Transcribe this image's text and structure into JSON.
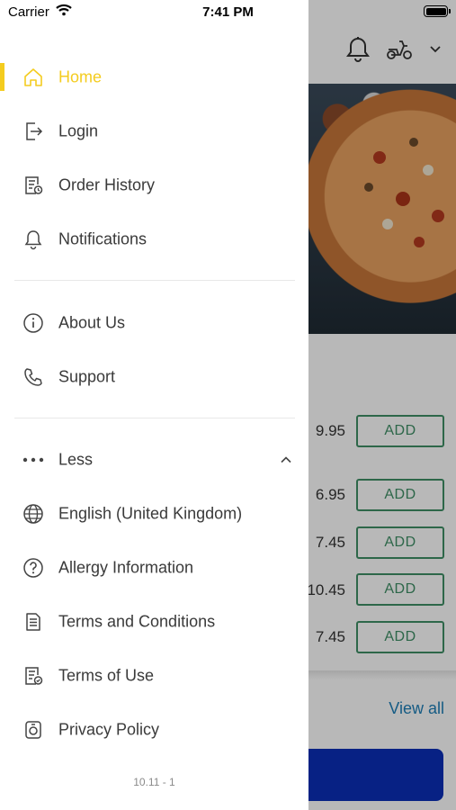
{
  "status_bar": {
    "carrier": "Carrier",
    "time": "7:41 PM"
  },
  "background": {
    "prices": [
      "9.95",
      "6.95",
      "7.45",
      "10.45",
      "7.45"
    ],
    "add_label": "ADD",
    "view_all": "View all",
    "icons": [
      "bell-icon",
      "scooter-icon",
      "chevron-down-icon"
    ]
  },
  "drawer": {
    "items": [
      {
        "label": "Home",
        "icon": "home-icon",
        "active": true
      },
      {
        "label": "Login",
        "icon": "login-icon"
      },
      {
        "label": "Order History",
        "icon": "order-history-icon"
      },
      {
        "label": "Notifications",
        "icon": "bell-icon"
      }
    ],
    "info_items": [
      {
        "label": "About Us",
        "icon": "info-icon"
      },
      {
        "label": "Support",
        "icon": "phone-icon"
      }
    ],
    "more_toggle": {
      "label": "Less",
      "icon": "ellipsis-icon",
      "state_icon": "chevron-up-icon"
    },
    "extra_items": [
      {
        "label": "English (United Kingdom)",
        "icon": "globe-icon"
      },
      {
        "label": "Allergy Information",
        "icon": "question-icon"
      },
      {
        "label": "Terms and Conditions",
        "icon": "document-icon"
      },
      {
        "label": "Terms of Use",
        "icon": "document-check-icon"
      },
      {
        "label": "Privacy Policy",
        "icon": "privacy-icon"
      }
    ],
    "version": "10.11 - 1"
  },
  "colors": {
    "accent": "#f4cc1f",
    "text": "#3a3a3a",
    "add_green": "#3f8f66",
    "link_blue": "#1e7fb8",
    "cta_blue": "#0a2fb8"
  }
}
